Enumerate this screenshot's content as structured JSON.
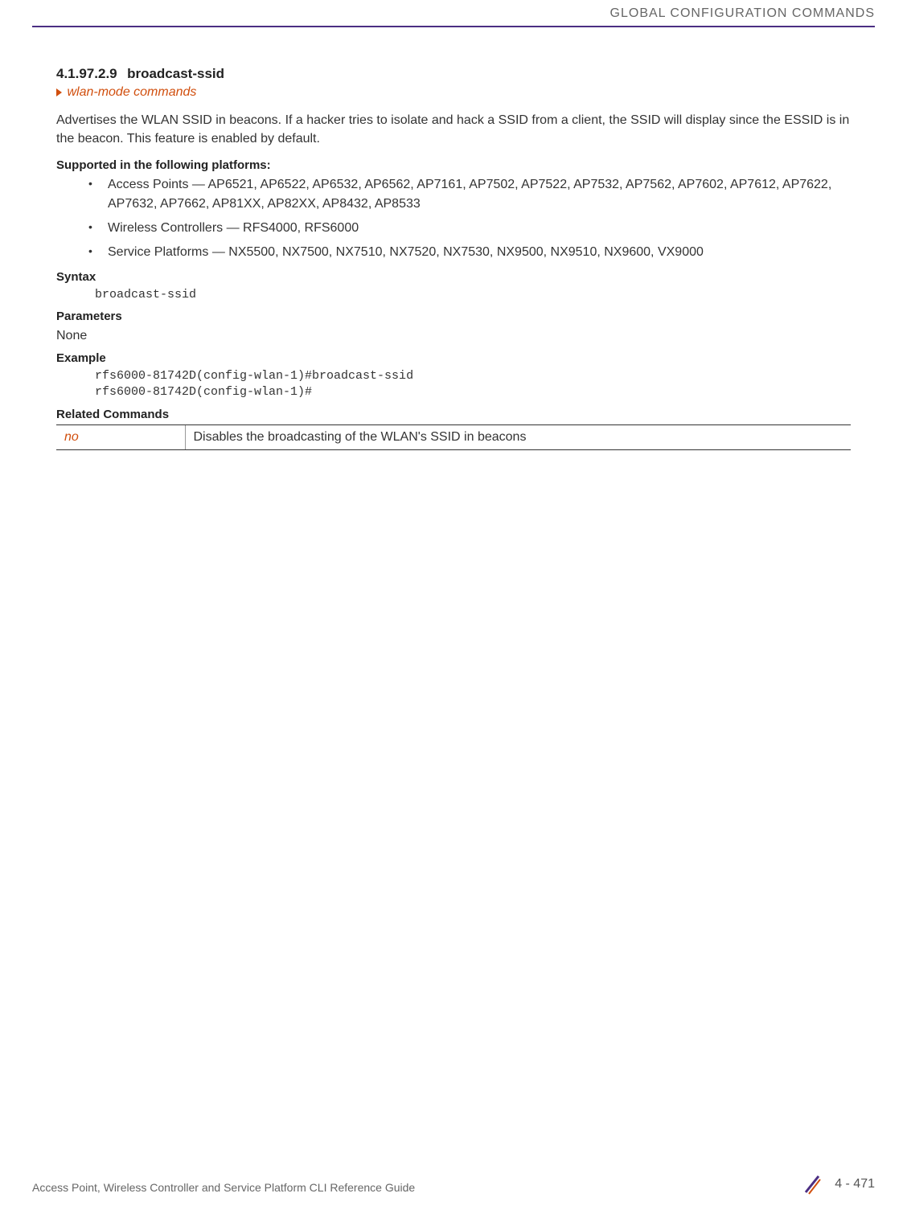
{
  "header": {
    "title": "GLOBAL CONFIGURATION COMMANDS"
  },
  "section": {
    "number": "4.1.97.2.9",
    "title": "broadcast-ssid",
    "link": "wlan-mode commands",
    "description": "Advertises the WLAN SSID in beacons. If a hacker tries to isolate and hack a SSID from a client, the SSID will display since the ESSID is in the beacon. This feature is enabled by default."
  },
  "supported": {
    "heading": "Supported in the following platforms:",
    "items": [
      "Access Points — AP6521, AP6522, AP6532, AP6562, AP7161, AP7502, AP7522, AP7532, AP7562, AP7602, AP7612, AP7622, AP7632, AP7662, AP81XX, AP82XX, AP8432, AP8533",
      "Wireless Controllers — RFS4000, RFS6000",
      "Service Platforms — NX5500, NX7500, NX7510, NX7520, NX7530, NX9500, NX9510, NX9600, VX9000"
    ]
  },
  "syntax": {
    "heading": "Syntax",
    "code": "broadcast-ssid"
  },
  "parameters": {
    "heading": "Parameters",
    "value": "None"
  },
  "example": {
    "heading": "Example",
    "code": "rfs6000-81742D(config-wlan-1)#broadcast-ssid\nrfs6000-81742D(config-wlan-1)#"
  },
  "related": {
    "heading": "Related Commands",
    "rows": [
      {
        "cmd": "no",
        "desc": "Disables the broadcasting of the WLAN's SSID in beacons"
      }
    ]
  },
  "footer": {
    "text": "Access Point, Wireless Controller and Service Platform CLI Reference Guide",
    "page": "4 - 471"
  }
}
